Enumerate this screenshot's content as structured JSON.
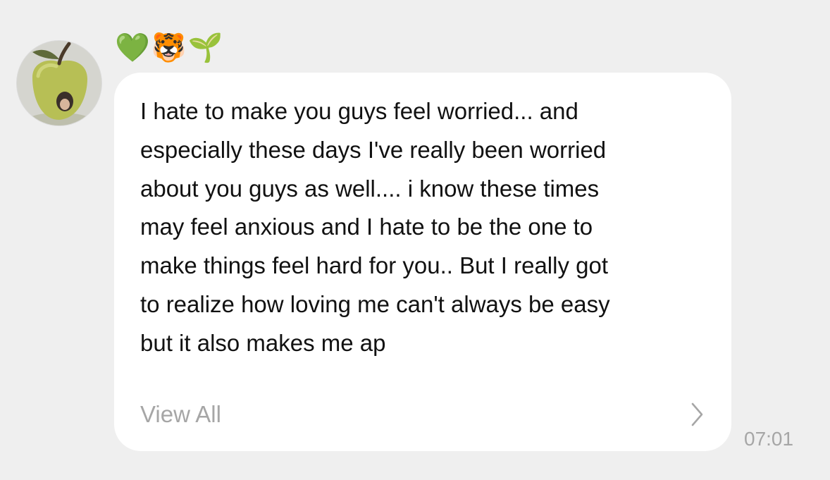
{
  "sender": {
    "name": "💚🐯🌱"
  },
  "message": {
    "text": "I hate to make you guys feel worried... and\nespecially these days I've really been worried\nabout you guys as well.... i know these times\nmay feel anxious and I hate to be the one to\nmake things feel hard for you.. But I really got\nto realize how loving me can't always be easy\nbut it also makes me ap",
    "view_all_label": "View All",
    "timestamp": "07:01"
  },
  "icons": {
    "view_all": "chevron-right-icon",
    "avatar": "apple-avatar"
  },
  "colors": {
    "background": "#efefef",
    "bubble": "#ffffff",
    "text": "#111111",
    "muted": "#a6a6a6"
  }
}
